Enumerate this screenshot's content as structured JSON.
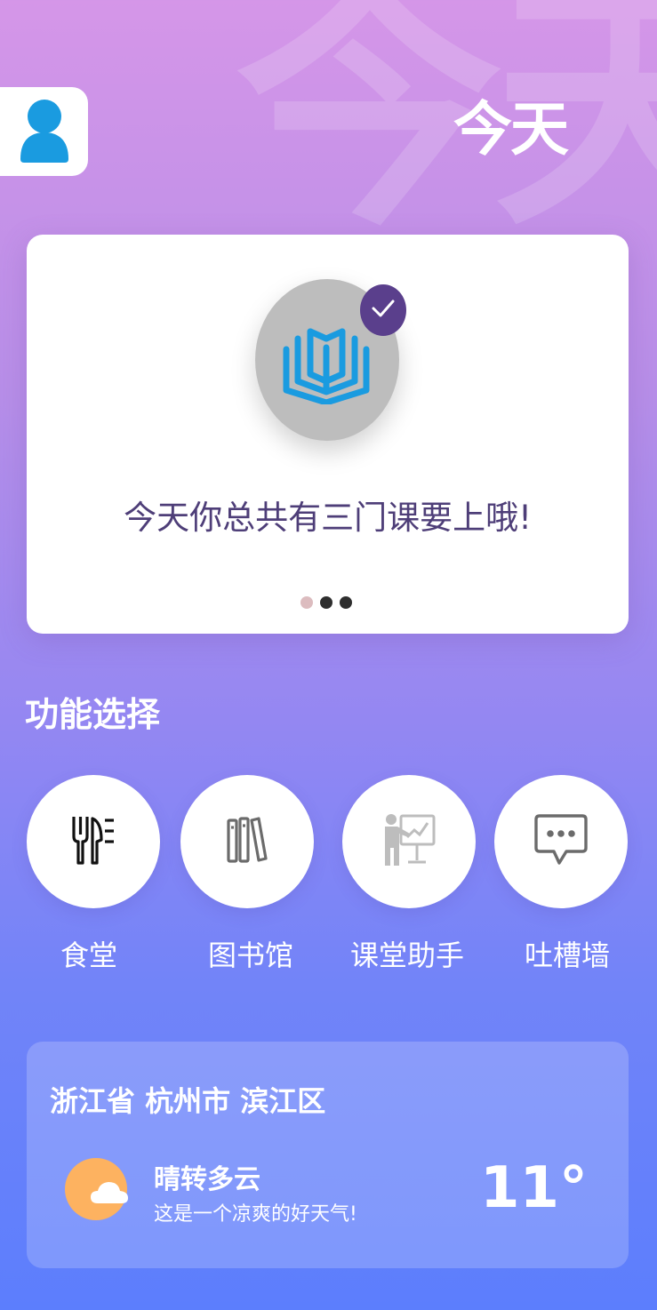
{
  "header": {
    "title": "今天",
    "watermark": "今天",
    "avatar_icon": "user-icon"
  },
  "banner": {
    "icon": "book-icon",
    "badge_icon": "check-icon",
    "message": "今天你总共有三门课要上哦!",
    "pagination": {
      "count": 3,
      "active_index": 0
    }
  },
  "functions": {
    "title": "功能选择",
    "items": [
      {
        "label": "食堂",
        "icon": "utensils-icon"
      },
      {
        "label": "图书馆",
        "icon": "books-icon"
      },
      {
        "label": "课堂助手",
        "icon": "teacher-board-icon"
      },
      {
        "label": "吐槽墙",
        "icon": "chat-bubble-icon"
      }
    ]
  },
  "weather": {
    "location": "浙江省 杭州市 滨江区",
    "condition": "晴转多云",
    "description": "这是一个凉爽的好天气!",
    "temperature": "11°",
    "icon": "partly-cloudy-icon"
  },
  "colors": {
    "accent_purple": "#5a3f8c",
    "icon_blue": "#1a9be0",
    "sun_orange": "#fdb260"
  }
}
